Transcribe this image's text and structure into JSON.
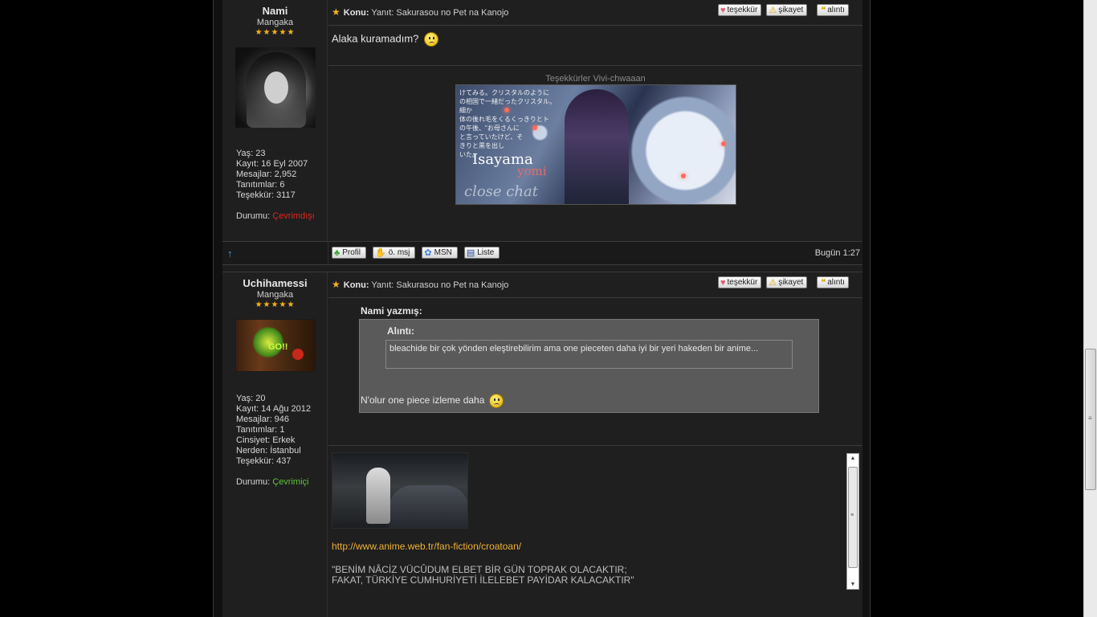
{
  "post1": {
    "author": {
      "name": "Nami",
      "rank": "Mangaka",
      "stars": "★★★★★",
      "stats": [
        "Yaş: 23",
        "Kayıt: 16 Eyl 2007",
        "Mesajlar: 2,952",
        "Tanıtımlar: 6",
        "Teşekkür: 3117"
      ],
      "status_label": "Durumu:",
      "status_value": "Çevrimdışı"
    },
    "subject_label": "Konu:",
    "subject": "Yanıt: Sakurasou no Pet na Kanojo",
    "message": "Alaka kuramadım?",
    "signature_title": "Teşekkürler Vivi-chwaaan",
    "banner": {
      "name_top": "Isayama",
      "name_bottom": "yomi",
      "script_text": "close chat",
      "jp_lines": [
        "けてみる。クリスタルのように",
        "の相国で一緒だったクリスタル。細か",
        "体の後れ毛をくるくっきりとト",
        "の午後、\"お母さんに",
        "と言っていたけど、そ",
        "きりと黒を出し",
        "いた。"
      ]
    },
    "footer": {
      "buttons": [
        {
          "icon": "♣",
          "label": "Profil"
        },
        {
          "icon": "✋",
          "label": "ö. msj"
        },
        {
          "icon": "✿",
          "label": "MSN"
        },
        {
          "icon": "▤",
          "label": "Liste"
        }
      ],
      "date": "Bugün 1:27"
    }
  },
  "post_buttons": {
    "thanks": "teşekkür",
    "report": "şikayet",
    "quote": "alıntı"
  },
  "post2": {
    "author": {
      "name": "Uchihamessi",
      "rank": "Mangaka",
      "stars": "★★★★★",
      "avatar_text": "GO!!",
      "stats": [
        "Yaş: 20",
        "Kayıt: 14 Ağu 2012",
        "Mesajlar: 946",
        "Tanıtımlar: 1",
        "Cinsiyet: Erkek",
        "Nerden: İstanbul",
        "Teşekkür: 437"
      ],
      "status_label": "Durumu:",
      "status_value": "Çevrimiçi"
    },
    "subject_label": "Konu:",
    "subject": "Yanıt: Sakurasou no Pet na Kanojo",
    "quote_by": "Nami yazmış:",
    "quote_label": "Alıntı:",
    "quote_text": "bleachide bir çok yönden eleştirebilirim ama one pieceten daha iyi bir yeri hakeden bir anime...",
    "reply": "N'olur one piece izleme daha",
    "signature": {
      "link": "http://www.anime.web.tr/fan-fiction/croatoan/",
      "quote_line1": "\"BENİM NÂCİZ VÜCÛDUM ELBET BİR GÜN TOPRAK OLACAKTIR;",
      "quote_line2": "FAKAT, TÜRKİYE CUMHURİYETİ İLELEBET PAYİDAR KALACAKTIR\""
    }
  },
  "colors": {
    "offline": "#e0261a",
    "online": "#5cc33a",
    "link": "#f0b135",
    "star": "#f7b21b"
  }
}
